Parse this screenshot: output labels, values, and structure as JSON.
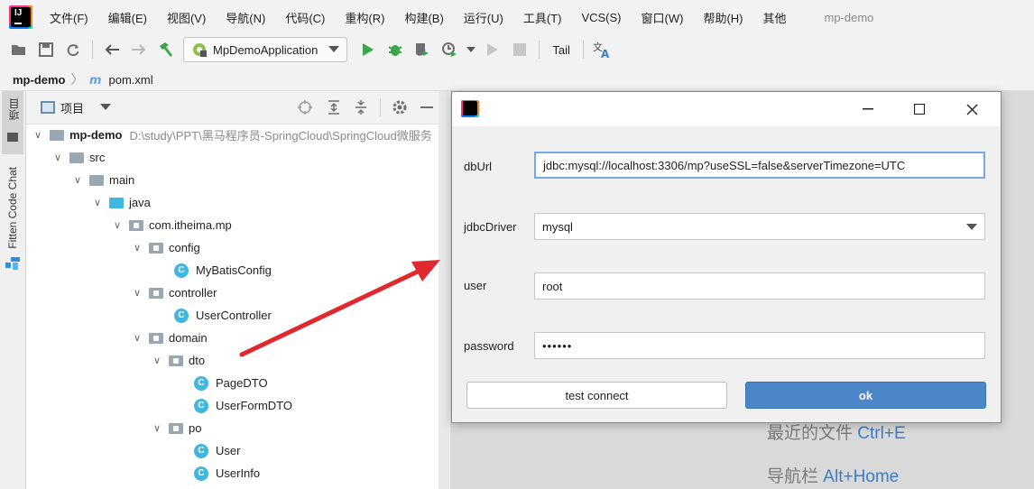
{
  "menubar": {
    "items": [
      "文件(F)",
      "编辑(E)",
      "视图(V)",
      "导航(N)",
      "代码(C)",
      "重构(R)",
      "构建(B)",
      "运行(U)",
      "工具(T)",
      "VCS(S)",
      "窗口(W)",
      "帮助(H)",
      "其他"
    ],
    "project_name": "mp-demo"
  },
  "toolbar": {
    "run_config": "MpDemoApplication",
    "tail": "Tail"
  },
  "breadcrumb": {
    "project": "mp-demo",
    "file": "pom.xml"
  },
  "left_stripe": {
    "project_tab": "项目",
    "fitten_tab": "Fitten Code Chat"
  },
  "project_panel": {
    "title": "项目",
    "root_name": "mp-demo",
    "root_path": "D:\\study\\PPT\\黑马程序员-SpringCloud\\SpringCloud微服务",
    "tree": [
      {
        "label": "src"
      },
      {
        "label": "main"
      },
      {
        "label": "java"
      },
      {
        "label": "com.itheima.mp"
      },
      {
        "label": "config"
      },
      {
        "label": "MyBatisConfig"
      },
      {
        "label": "controller"
      },
      {
        "label": "UserController"
      },
      {
        "label": "domain"
      },
      {
        "label": "dto"
      },
      {
        "label": "PageDTO"
      },
      {
        "label": "UserFormDTO"
      },
      {
        "label": "po"
      },
      {
        "label": "User"
      },
      {
        "label": "UserInfo"
      }
    ]
  },
  "editor_hints": [
    {
      "text": "最近的文件",
      "key": "Ctrl+E"
    },
    {
      "text": "导航栏",
      "key": "Alt+Home"
    }
  ],
  "dialog": {
    "fields": {
      "dburl_label": "dbUrl",
      "dburl_value": "jdbc:mysql://localhost:3306/mp?useSSL=false&serverTimezone=UTC",
      "driver_label": "jdbcDriver",
      "driver_value": "mysql",
      "user_label": "user",
      "user_value": "root",
      "password_label": "password",
      "password_value": "••••••"
    },
    "buttons": {
      "test": "test connect",
      "ok": "ok"
    }
  },
  "colors": {
    "accent": "#4a86c8",
    "class_icon": "#40b6e0",
    "arrow": "#e0282e",
    "run_green": "#3aa54a"
  }
}
